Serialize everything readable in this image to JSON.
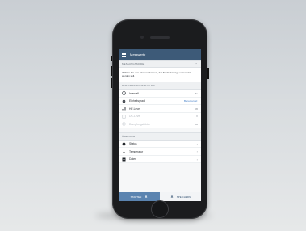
{
  "app": {
    "title": "Messwerte"
  },
  "sections": {
    "einstellungen": {
      "title": "MESSUNGSMODE",
      "info": "Wählen Sie den Messmodus aus, der für die Anzeige verwendet werden soll."
    },
    "parameter": {
      "title": "PARAMETEREINSTELLUNG"
    },
    "overview": {
      "title": "ÜBERSICHT"
    }
  },
  "params": [
    {
      "label": "Intervall",
      "value": "5s",
      "icon": "clock-icon",
      "disabled": false
    },
    {
      "label": "Einheitsgrad",
      "value": "Benutzerdef.",
      "icon": "gear-icon",
      "disabled": false
    },
    {
      "label": "HF-Level",
      "value": "dB",
      "icon": "signal-icon",
      "disabled": false
    },
    {
      "label": "DC-Level",
      "value": "V",
      "icon": "dc-icon",
      "disabled": true
    },
    {
      "label": "Dämpfungsfaktor",
      "value": "dB",
      "icon": "damping-icon",
      "disabled": true
    }
  ],
  "overview": [
    {
      "label": "Status",
      "icon": "status-dot-icon"
    },
    {
      "label": "Temperatur",
      "icon": "thermometer-icon"
    },
    {
      "label": "Daten",
      "icon": "data-icon"
    }
  ],
  "bottom": {
    "primary": "STARTEN",
    "secondary": "SPEICHERN"
  },
  "colors": {
    "appbar": "#3d5a78",
    "accent": "#3b79c4",
    "page_bg": "#d8dcdf"
  }
}
